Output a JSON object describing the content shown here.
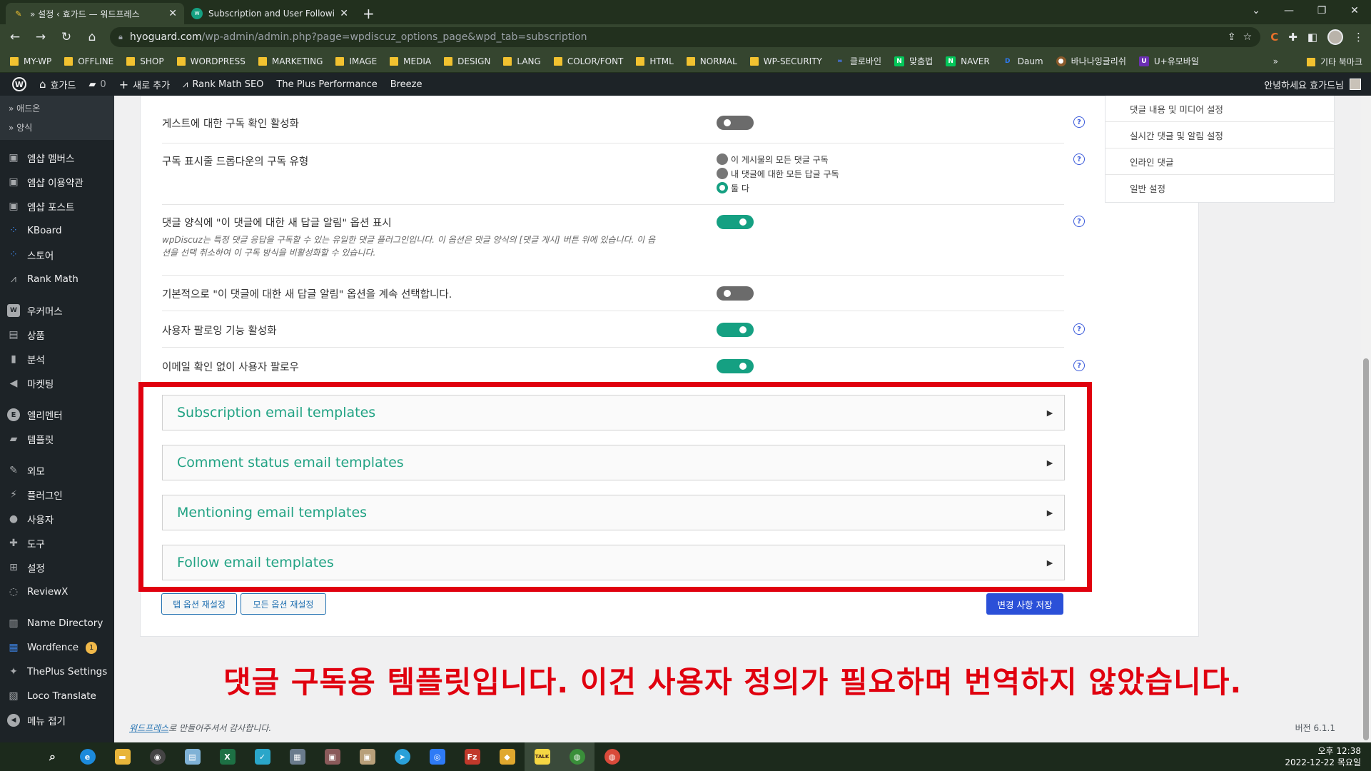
{
  "browser": {
    "tabs": [
      {
        "title": "» 설정 ‹ 효가드 — 워드프레스",
        "active": true
      },
      {
        "title": "Subscription and User Following",
        "active": false
      }
    ],
    "url_domain": "hyoguard.com",
    "url_path": "/wp-admin/admin.php?page=wpdiscuz_options_page&wpd_tab=subscription",
    "bookmarks": [
      "MY-WP",
      "OFFLINE",
      "SHOP",
      "WORDPRESS",
      "MARKETING",
      "IMAGE",
      "MEDIA",
      "DESIGN",
      "LANG",
      "COLOR/FONT",
      "HTML",
      "NORMAL",
      "WP-SECURITY"
    ],
    "bookmark_sites": [
      {
        "label": "클로바인",
        "icon": "∞",
        "color": "#4a7cff"
      },
      {
        "label": "맞춤법",
        "icon": "N",
        "color": "#03c75a"
      },
      {
        "label": "NAVER",
        "icon": "N",
        "color": "#03c75a"
      },
      {
        "label": "Daum",
        "icon": "D",
        "color": "#2e7bf6"
      },
      {
        "label": "바나나잉글리쉬",
        "icon": "●",
        "color": "#8b5a2b"
      },
      {
        "label": "U+유모바일",
        "icon": "U",
        "color": "#6b2fb3"
      }
    ],
    "bookmarks_more": "»",
    "other_bookmarks": "기타 북마크"
  },
  "adminbar": {
    "site_name": "효가드",
    "comments_count": "0",
    "new_label": "새로 추가",
    "items": [
      "Rank Math SEO",
      "The Plus Performance",
      "Breeze"
    ],
    "greeting": "안녕하세요 효가드님"
  },
  "sidebar": {
    "subitems": [
      "» 애드온",
      "» 양식"
    ],
    "items": [
      {
        "label": "엠샵 멤버스",
        "icon": "cube-icon",
        "glyph": "▣"
      },
      {
        "label": "엠샵 이용약관",
        "icon": "cube-icon",
        "glyph": "▣"
      },
      {
        "label": "엠샵 포스트",
        "icon": "cube-icon",
        "glyph": "▣"
      },
      {
        "label": "KBoard",
        "icon": "dots-icon",
        "glyph": "⁘"
      },
      {
        "label": "스토어",
        "icon": "dots-icon",
        "glyph": "⁘"
      },
      {
        "label": "Rank Math",
        "icon": "chart-icon",
        "glyph": "⩘"
      },
      {
        "label": "우커머스",
        "icon": "woo-icon",
        "glyph": "W"
      },
      {
        "label": "상품",
        "icon": "archive-icon",
        "glyph": "▤"
      },
      {
        "label": "분석",
        "icon": "bar-chart-icon",
        "glyph": "▮"
      },
      {
        "label": "마켓팅",
        "icon": "megaphone-icon",
        "glyph": "◀"
      },
      {
        "label": "엘리멘터",
        "icon": "elementor-icon",
        "glyph": "E"
      },
      {
        "label": "템플릿",
        "icon": "folder-icon",
        "glyph": "▰"
      },
      {
        "label": "외모",
        "icon": "brush-icon",
        "glyph": "✎"
      },
      {
        "label": "플러그인",
        "icon": "plugin-icon",
        "glyph": "⚡"
      },
      {
        "label": "사용자",
        "icon": "user-icon",
        "glyph": "●"
      },
      {
        "label": "도구",
        "icon": "wrench-icon",
        "glyph": "✚"
      },
      {
        "label": "설정",
        "icon": "settings-icon",
        "glyph": "⊞"
      },
      {
        "label": "ReviewX",
        "icon": "reviewx-icon",
        "glyph": "◌"
      },
      {
        "label": "Name Directory",
        "icon": "book-icon",
        "glyph": "▥"
      },
      {
        "label": "Wordfence",
        "icon": "wordfence-icon",
        "glyph": "▦",
        "badge": "1"
      },
      {
        "label": "ThePlus Settings",
        "icon": "plus-icon",
        "glyph": "✦"
      },
      {
        "label": "Loco Translate",
        "icon": "translate-icon",
        "glyph": "▧"
      },
      {
        "label": "메뉴 접기",
        "icon": "collapse-icon",
        "glyph": "◀"
      }
    ]
  },
  "settings": {
    "rows": [
      {
        "label": "게스트에 대한 구독 확인 활성화",
        "type": "toggle",
        "on": false,
        "help": true
      },
      {
        "label": "구독 표시줄 드롭다운의 구독 유형",
        "type": "radio",
        "help": true,
        "options": [
          "이 게시물의 모든 댓글 구독",
          "내 댓글에 대한 모든 답글 구독",
          "둘 다"
        ],
        "selected": 2
      },
      {
        "label": "댓글 양식에 \"이 댓글에 대한 새 답글 알림\" 옵션 표시",
        "type": "toggle",
        "on": true,
        "help": true,
        "desc": "wpDiscuz는 특정 댓글 응답을 구독할 수 있는 유일한 댓글 플러그인입니다. 이 옵션은 댓글 양식의 [댓글 게시] 버튼 위에 있습니다. 이 옵션을 선택 취소하여 이 구독 방식을 비활성화할 수 있습니다."
      },
      {
        "label": "기본적으로 \"이 댓글에 대한 새 답글 알림\" 옵션을 계속 선택합니다.",
        "type": "toggle",
        "on": false,
        "help": false
      },
      {
        "label": "사용자 팔로잉 기능 활성화",
        "type": "toggle",
        "on": true,
        "help": true
      },
      {
        "label": "이메일 확인 없이 사용자 팔로우",
        "type": "toggle",
        "on": true,
        "help": true
      }
    ],
    "help_glyph": "?",
    "accordions": [
      "Subscription email templates",
      "Comment status email templates",
      "Mentioning email templates",
      "Follow email templates"
    ],
    "accordion_arrow": "▶",
    "reset_tab_label": "탭 옵션 재설정",
    "reset_all_label": "모든 옵션 재설정",
    "save_label": "변경 사항 저장"
  },
  "right_nav": [
    "댓글 내용 및 미디어 설정",
    "실시간 댓글 및 알림 설정",
    "인라인 댓글",
    "일반 설정"
  ],
  "annotation": "댓글 구독용 템플릿입니다. 이건 사용자 정의가 필요하며 번역하지 않았습니다.",
  "footer": {
    "link": "워드프레스",
    "text": "로 만들어주셔서 감사합니다.",
    "version": "버전 6.1.1"
  },
  "taskbar": {
    "apps": [
      {
        "name": "edge",
        "color": "#1c8adb",
        "glyph": "e"
      },
      {
        "name": "explorer",
        "color": "#e8b53a",
        "glyph": "▬"
      },
      {
        "name": "obs",
        "color": "#444",
        "glyph": "◉"
      },
      {
        "name": "notepad",
        "color": "#7fb2d6",
        "glyph": "▤"
      },
      {
        "name": "excel",
        "color": "#1d7044",
        "glyph": "X"
      },
      {
        "name": "app-bird",
        "color": "#2aa6c9",
        "glyph": "✓"
      },
      {
        "name": "calculator",
        "color": "#6a7b8c",
        "glyph": "▦"
      },
      {
        "name": "app-photo",
        "color": "#8a5a5a",
        "glyph": "▣"
      },
      {
        "name": "app-portrait",
        "color": "#b8a07a",
        "glyph": "▣"
      },
      {
        "name": "telegram",
        "color": "#2aa0d9",
        "glyph": "➤"
      },
      {
        "name": "app-camera",
        "color": "#2e7bf6",
        "glyph": "◎"
      },
      {
        "name": "filezilla",
        "color": "#c0392b",
        "glyph": "Fz"
      },
      {
        "name": "app-tiles",
        "color": "#e0a82e",
        "glyph": "◆"
      },
      {
        "name": "kakaotalk",
        "color": "#f6d743",
        "glyph": "TALK"
      },
      {
        "name": "chrome",
        "color": "#3a8f3a",
        "glyph": "◍"
      },
      {
        "name": "chrome-profile",
        "color": "#d94a3a",
        "glyph": "◍"
      }
    ],
    "time": "오후 12:38",
    "date": "2022-12-22 목요일"
  }
}
